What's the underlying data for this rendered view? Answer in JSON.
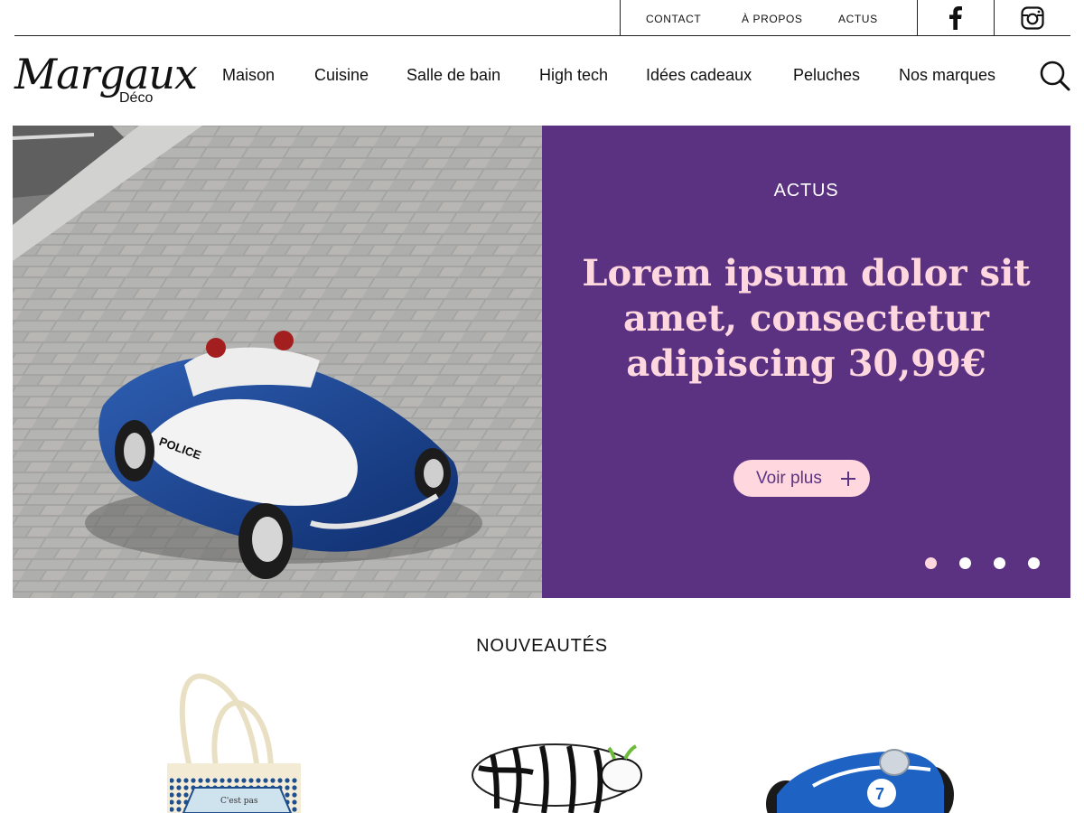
{
  "utility_nav": {
    "links": [
      "CONTACT",
      "À PROPOS",
      "ACTUS"
    ],
    "social": [
      {
        "icon": "facebook-icon"
      },
      {
        "icon": "instagram-icon"
      }
    ]
  },
  "brand": {
    "name": "Margaux",
    "sub": "Déco"
  },
  "main_nav": [
    "Maison",
    "Cuisine",
    "Salle de bain",
    "High tech",
    "Idées cadeaux",
    "Peluches",
    "Nos marques"
  ],
  "search": {
    "icon": "search-icon"
  },
  "hero": {
    "image": "police-car-toy-photo",
    "kicker": "ACTUS",
    "title": "Lorem ipsum dolor sit amet, consectetur adipiscing 30,99€",
    "cta_label": "Voir plus",
    "slides_total": 4,
    "active_slide": 1
  },
  "new_items": {
    "title": "NOUVEAUTÉS",
    "products": [
      {
        "image": "tote-bag-photo",
        "bag_text": "C'est pas"
      },
      {
        "image": "zebra-figurine-photo"
      },
      {
        "image": "blue-race-car-toy-photo",
        "car_number": "7"
      }
    ]
  },
  "colors": {
    "accent_purple": "#5b3282",
    "accent_pink": "#ffd8df",
    "text": "#111111"
  }
}
